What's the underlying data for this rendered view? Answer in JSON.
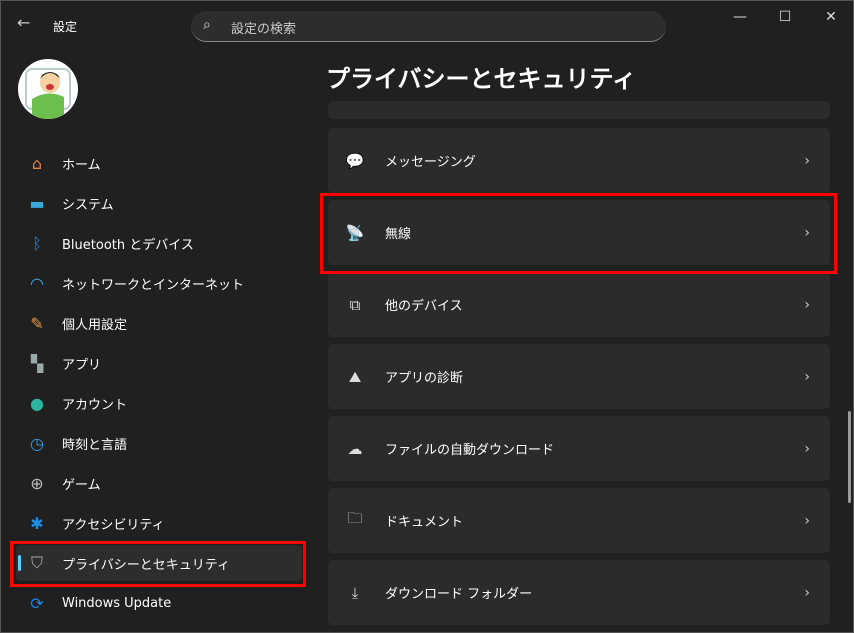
{
  "window": {
    "title": "設定",
    "minimize": "—",
    "maximize": "☐",
    "close": "✕"
  },
  "search": {
    "placeholder": "設定の検索"
  },
  "page_title": "プライバシーとセキュリティ",
  "sidebar": {
    "items": [
      {
        "label": "ホーム",
        "icon": "home-icon",
        "glyph": "⌂",
        "color": "#e8814a"
      },
      {
        "label": "システム",
        "icon": "system-icon",
        "glyph": "▬",
        "color": "#3aa7d8"
      },
      {
        "label": "Bluetooth とデバイス",
        "icon": "bluetooth-icon",
        "glyph": "ᛒ",
        "color": "#1a86ef"
      },
      {
        "label": "ネットワークとインターネット",
        "icon": "wifi-icon",
        "glyph": "◠",
        "color": "#3aa7e8"
      },
      {
        "label": "個人用設定",
        "icon": "brush-icon",
        "glyph": "✎",
        "color": "#e39a4a"
      },
      {
        "label": "アプリ",
        "icon": "apps-icon",
        "glyph": "▚",
        "color": "#9aa"
      },
      {
        "label": "アカウント",
        "icon": "account-icon",
        "glyph": "●",
        "color": "#2ab5a0"
      },
      {
        "label": "時刻と言語",
        "icon": "time-language-icon",
        "glyph": "◷",
        "color": "#3a9ee0"
      },
      {
        "label": "ゲーム",
        "icon": "gamepad-icon",
        "glyph": "⊕",
        "color": "#bbb"
      },
      {
        "label": "アクセシビリティ",
        "icon": "accessibility-icon",
        "glyph": "✱",
        "color": "#1a8fe8"
      },
      {
        "label": "プライバシーとセキュリティ",
        "icon": "shield-icon",
        "glyph": "⛉",
        "color": "#aaa",
        "selected": true
      },
      {
        "label": "Windows Update",
        "icon": "update-icon",
        "glyph": "⟳",
        "color": "#1a86ef"
      }
    ]
  },
  "cards": [
    {
      "label": "メッセージング",
      "icon": "message-icon",
      "glyph": "💬"
    },
    {
      "label": "無線",
      "icon": "radio-tower-icon",
      "glyph": "📡"
    },
    {
      "label": "他のデバイス",
      "icon": "devices-icon",
      "glyph": "⧉"
    },
    {
      "label": "アプリの診断",
      "icon": "diagnostics-icon",
      "glyph": "⛰"
    },
    {
      "label": "ファイルの自動ダウンロード",
      "icon": "cloud-icon",
      "glyph": "☁"
    },
    {
      "label": "ドキュメント",
      "icon": "documents-icon",
      "glyph": "🗀"
    },
    {
      "label": "ダウンロード フォルダー",
      "icon": "download-folder-icon",
      "glyph": "⤓"
    }
  ],
  "chevron": "›"
}
